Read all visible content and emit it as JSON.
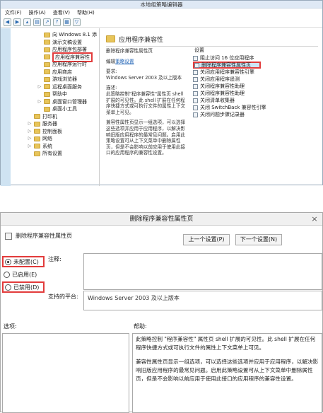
{
  "gpedit": {
    "title": "本地组策略编辑器",
    "menu": [
      "文件(F)",
      "操作(A)",
      "查看(V)",
      "帮助(H)"
    ],
    "tree": [
      {
        "label": "向 Windows 8.1 添",
        "expand": ""
      },
      {
        "label": "演示文稿设置",
        "expand": ""
      },
      {
        "label": "应用程序包部署",
        "expand": ""
      },
      {
        "label": "应用程序兼容性",
        "expand": "",
        "selected": true
      },
      {
        "label": "应用程序运行时",
        "expand": ""
      },
      {
        "label": "应用商店",
        "expand": ""
      },
      {
        "label": "游戏浏览器",
        "expand": ""
      },
      {
        "label": "远程桌面服务",
        "expand": "▷"
      },
      {
        "label": "帮助中",
        "expand": ""
      },
      {
        "label": "桌面窗口管理器",
        "expand": "▷"
      },
      {
        "label": "桌面小工具",
        "expand": ""
      },
      {
        "label": "打印机",
        "expand": ""
      },
      {
        "label": "服务器",
        "expand": "▷"
      },
      {
        "label": "控制面板",
        "expand": "▷"
      },
      {
        "label": "网络",
        "expand": "▷"
      },
      {
        "label": "系统",
        "expand": "▷"
      },
      {
        "label": "所有设置",
        "expand": ""
      }
    ],
    "right_header": "应用程序兼容性",
    "desc": {
      "title": "删除程序兼容性属性页",
      "edit_prefix": "编辑",
      "edit_link": "策略设置",
      "requirements_label": "要求:",
      "requirements": "Windows Server 2003 及以上版本",
      "description_label": "描述:",
      "description": "此策略控制\"程序兼容性\"属性页 shell 扩展的可见性。此 shell 扩展在任何程序快捷方式或可执行文件的属性上下文菜单上可见。",
      "description2": "兼容性属性页显示一组选项，可以选择这些选项并应用于应用程序，以解决影响旧版应用程序的最常见问题。启用此策略设置可从上下文菜单中删除属性页，但是不会影响以前应用于使用此接口的应用程序的兼容性设置。"
    },
    "settings_label": "设置",
    "settings": [
      {
        "label": "阻止访问 16 位应用程序",
        "selected": false
      },
      {
        "label": "删除程序兼容性属性页",
        "selected": true
      },
      {
        "label": "关闭应用程序兼容性引擎",
        "selected": false
      },
      {
        "label": "关闭应用程序遥测",
        "selected": false
      },
      {
        "label": "关闭程序兼容性助理",
        "selected": false
      },
      {
        "label": "关闭程序兼容性助理",
        "selected": false
      },
      {
        "label": "关闭清单收集器",
        "selected": false
      },
      {
        "label": "关闭 SwitchBack 兼容性引擎",
        "selected": false
      },
      {
        "label": "关闭问题步骤记录器",
        "selected": false
      }
    ]
  },
  "dialog": {
    "title": "删除程序兼容性属性页",
    "close": "×",
    "policy_name": "删除程序兼容性属性页",
    "prev_button": "上一个设置(P)",
    "next_button": "下一个设置(N)",
    "radios": [
      {
        "label": "未配置(C)",
        "checked": true
      },
      {
        "label": "已启用(E)",
        "checked": false
      },
      {
        "label": "已禁用(D)",
        "checked": false
      }
    ],
    "comment_label": "注释:",
    "support_label": "支持的平台:",
    "support_value": "Windows Server 2003 及以上版本",
    "options_label": "选项:",
    "help_label": "帮助:",
    "help_text_1": "此策略控制 \"程序兼容性\" 属性页 shell 扩展的可见性。此 shell 扩展在任何程序快捷方式或可执行文件的属性上下文菜单上可见。",
    "help_text_2": "兼容性属性页显示一组选项，可以选择这些选项并应用于应用程序，以解决影响旧版应用程序的最常见问题。启用此策略设置可从上下文菜单中删除属性页，但是不会影响以前应用于使用此接口的应用程序的兼容性设置。"
  }
}
